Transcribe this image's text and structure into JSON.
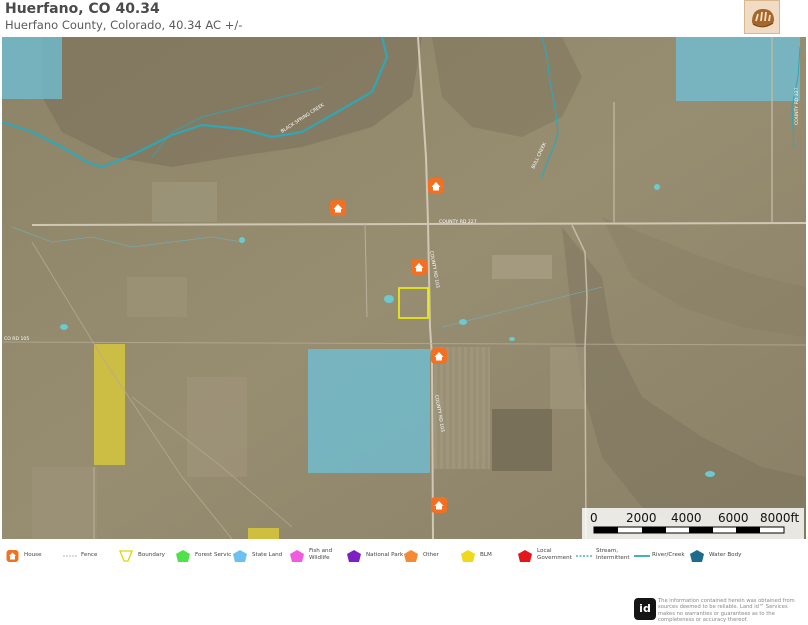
{
  "header": {
    "title": "Huerfano, CO 40.34",
    "subtitle": "Huerfano County, Colorado, 40.34 AC +/-"
  },
  "map": {
    "road_labels": {
      "county_rd_227": "COUNTY RD 227",
      "county_rd_103_north": "COUNTY RD 103",
      "county_rd_103_south": "COUNTY RD 103",
      "county_rd_105": "CO RD 105",
      "east_road": "COUNTY RD 227",
      "creek_north": "BLACK SPRING CREEK",
      "creek_east": "BULL CREEK"
    },
    "scale_bar": {
      "labels": [
        "0",
        "2000",
        "4000",
        "6000",
        "8000ft"
      ]
    },
    "colors": {
      "state_land": "#6cc1d9",
      "blm": "#d9c93a",
      "boundary": "#f2f20a",
      "house": "#f37022",
      "creek": "#2fa7b6"
    }
  },
  "legend": {
    "items": [
      {
        "label": "House",
        "icon": "house-icon"
      },
      {
        "label": "Fence",
        "icon": "fence-icon"
      },
      {
        "label": "Boundary",
        "icon": "boundary-icon"
      },
      {
        "label": "Forest Servic",
        "icon": "forest-service-icon"
      },
      {
        "label": "State Land",
        "icon": "state-land-icon"
      },
      {
        "label": "Fish and Wildlife",
        "icon": "fish-wildlife-icon"
      },
      {
        "label": "National Park",
        "icon": "national-park-icon"
      },
      {
        "label": "Other",
        "icon": "other-icon"
      },
      {
        "label": "BLM",
        "icon": "blm-icon"
      },
      {
        "label": "Local Government",
        "icon": "local-government-icon"
      },
      {
        "label": "Stream, Intermittent",
        "icon": "stream-icon"
      },
      {
        "label": "River/Creek",
        "icon": "river-icon"
      },
      {
        "label": "Water Body",
        "icon": "water-body-icon"
      }
    ]
  },
  "footer": {
    "badge": "id",
    "disclaimer": "The information contained herein was obtained from sources deemed to be reliable. Land id™ Services makes no warranties or guarantees as to the completeness or accuracy thereof."
  }
}
